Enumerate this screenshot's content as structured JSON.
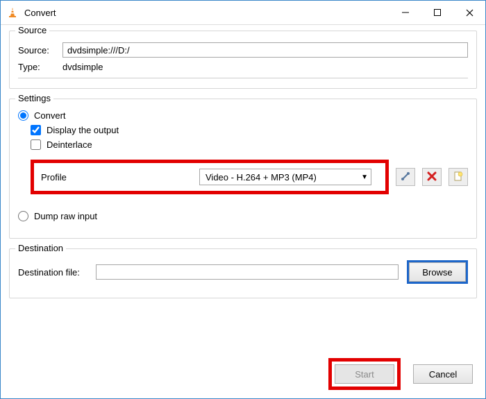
{
  "window": {
    "title": "Convert"
  },
  "source": {
    "legend": "Source",
    "source_label": "Source:",
    "source_value": "dvdsimple:///D:/",
    "type_label": "Type:",
    "type_value": "dvdsimple"
  },
  "settings": {
    "legend": "Settings",
    "convert_label": "Convert",
    "display_output_label": "Display the output",
    "deinterlace_label": "Deinterlace",
    "profile_label": "Profile",
    "profile_value": "Video - H.264 + MP3 (MP4)",
    "dump_raw_label": "Dump raw input"
  },
  "destination": {
    "legend": "Destination",
    "file_label": "Destination file:",
    "file_value": "",
    "browse_label": "Browse"
  },
  "footer": {
    "start_label": "Start",
    "cancel_label": "Cancel"
  },
  "icons": {
    "edit": "edit",
    "delete": "delete",
    "new": "new"
  }
}
